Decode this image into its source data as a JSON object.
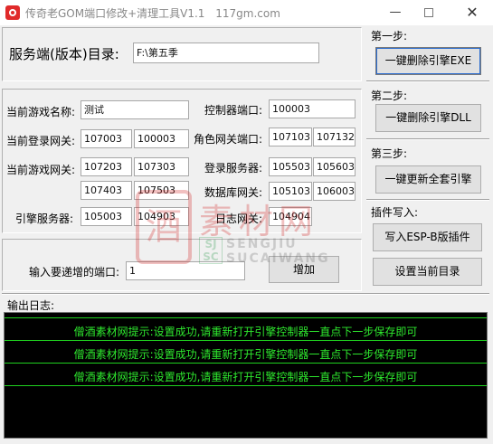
{
  "window": {
    "title": "传奇老GOM端口修改+清理工具V1.1",
    "site": "117gm.com",
    "min_glyph": "—",
    "close_glyph": "✕"
  },
  "server_dir": {
    "label": "服务端(版本)目录:",
    "value": "F:\\第五季"
  },
  "steps": {
    "step1_label": "第一步:",
    "step1_button": "一键删除引擎EXE",
    "step2_label": "第二步:",
    "step2_button": "一键删除引擎DLL",
    "step3_label": "第三步:",
    "step3_button": "一键更新全套引擎",
    "plugin_label": "插件写入:",
    "plugin_button": "写入ESP-B版插件",
    "set_dir_button": "设置当前目录"
  },
  "fields": {
    "game_name_label": "当前游戏名称:",
    "game_name_value": "测试",
    "controller_port_label": "控制器端口:",
    "controller_port_value": "100003",
    "login_gateway_label": "当前登录网关:",
    "login_gateway_1": "107003",
    "login_gateway_2": "100003",
    "role_gateway_label": "角色网关端口:",
    "role_gateway_1": "107103",
    "role_gateway_2": "107132",
    "game_gateway_label": "当前游戏网关:",
    "game_gateway_1": "107203",
    "game_gateway_2": "107303",
    "game_gateway_3": "107403",
    "game_gateway_4": "107503",
    "login_server_label": "登录服务器:",
    "login_server_1": "105503",
    "login_server_2": "105603",
    "db_gateway_label": "数据库网关:",
    "db_gateway_1": "105103",
    "db_gateway_2": "106003",
    "engine_server_label": "引擎服务器:",
    "engine_server_1": "105003",
    "engine_server_2": "104903",
    "log_gateway_label": "日志网关:",
    "log_gateway_1": "104904"
  },
  "increment": {
    "label": "输入要递增的端口:",
    "value": "1",
    "button": "增加"
  },
  "log": {
    "label": "输出日志:",
    "lines": [
      "僧酒素材网提示:设置成功,请重新打开引擎控制器一直点下一步保存即可",
      "僧酒素材网提示:设置成功,请重新打开引擎控制器一直点下一步保存即可",
      "僧酒素材网提示:设置成功,请重新打开引擎控制器一直点下一步保存即可"
    ]
  },
  "watermark": {
    "seal_char": "酒",
    "cn_text": "素材网",
    "badge_text": "SJ SC",
    "en_line1": "SENGJIU",
    "en_line2": "SUCAIWANG"
  },
  "colors": {
    "log_bg": "#000000",
    "log_text": "#2ee82e",
    "app_icon": "#e02a2a"
  }
}
